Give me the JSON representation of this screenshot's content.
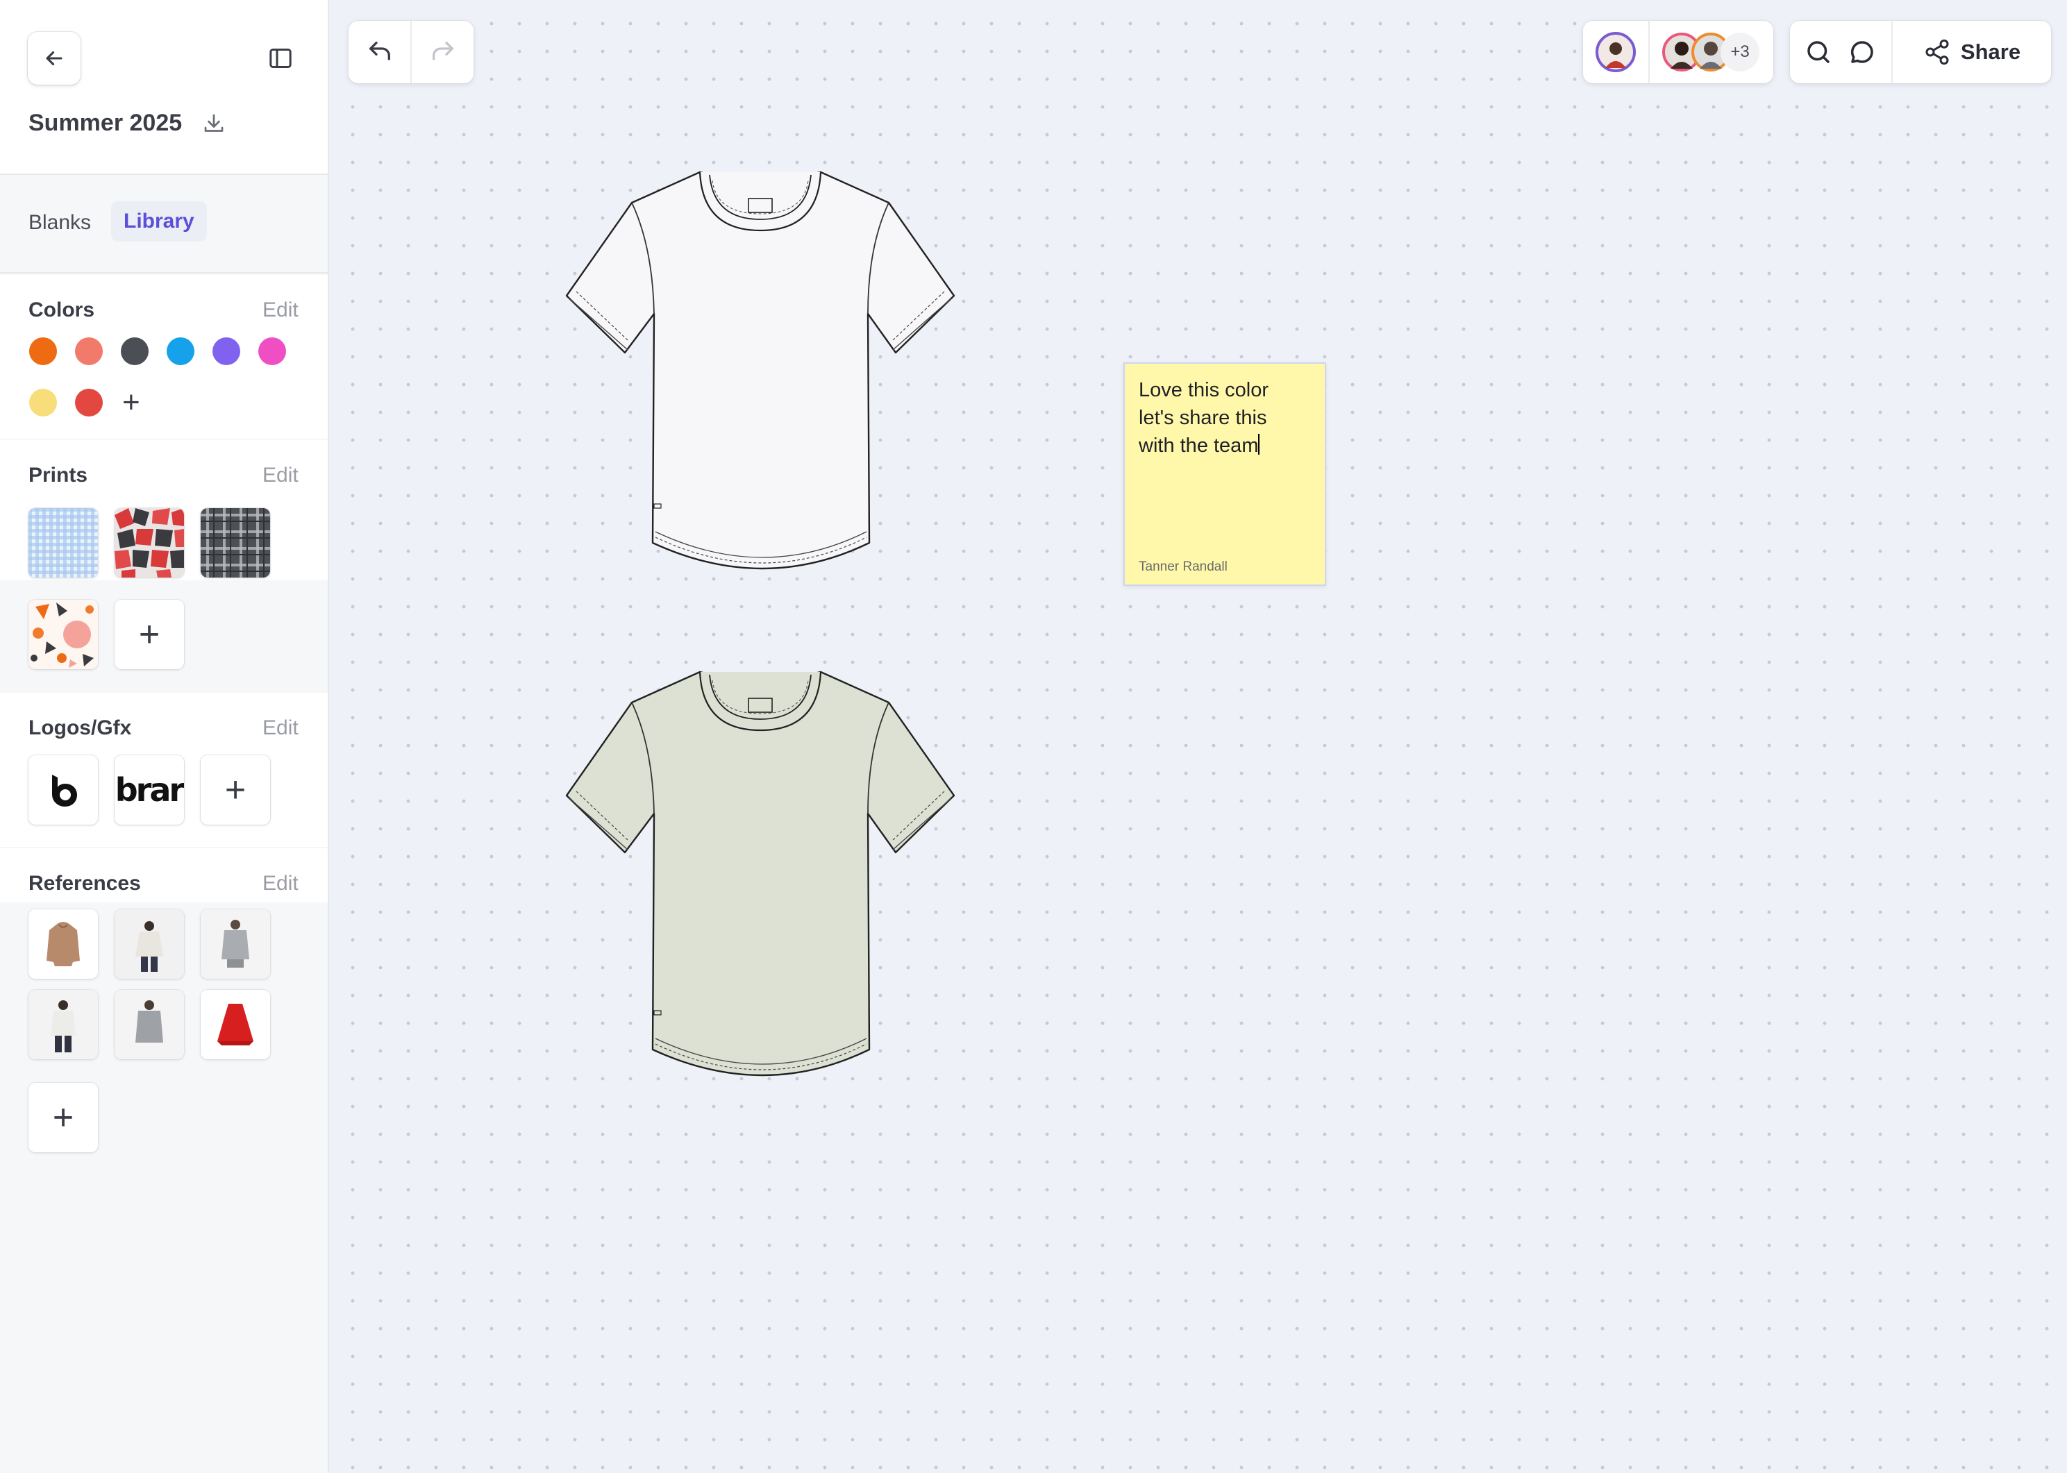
{
  "project": {
    "title": "Summer 2025"
  },
  "tabs": [
    {
      "label": "Blanks",
      "active": false
    },
    {
      "label": "Library",
      "active": true
    }
  ],
  "sections": {
    "colors": {
      "title": "Colors",
      "edit_label": "Edit",
      "swatches": [
        "#ee6a13",
        "#f17a6a",
        "#4b4f55",
        "#16a2ea",
        "#8162f0",
        "#ef4fc2",
        "#f7de7a",
        "#e2483f"
      ],
      "add_label": "+"
    },
    "prints": {
      "title": "Prints",
      "edit_label": "Edit",
      "items": [
        "blue-gingham-print",
        "red-geometric-print",
        "gray-plaid-print",
        "terrazzo-print"
      ],
      "add_label": "+"
    },
    "logos": {
      "title": "Logos/Gfx",
      "edit_label": "Edit",
      "items": [
        "b-logo",
        "brand-wordmark-logo"
      ],
      "wordmark_text": "ıbrar",
      "add_label": "+"
    },
    "references": {
      "title": "References",
      "edit_label": "Edit",
      "items": [
        "tan-hoodie-reference",
        "white-sweater-reference",
        "gray-tee-reference",
        "white-jacket-reference",
        "gray-shirt-reference",
        "red-dress-reference"
      ],
      "add_label": "+"
    }
  },
  "toolbar": {
    "undo_icon": "undo-icon",
    "redo_icon": "redo-icon",
    "collaborators_extra": "+3",
    "share_label": "Share"
  },
  "canvas": {
    "garments": [
      {
        "name": "white-tshirt",
        "color": "#f7f7fa"
      },
      {
        "name": "sage-tshirt",
        "color": "#dde1d3"
      }
    ],
    "sticky_note": {
      "text": "Love this color\nlet's share this\nwith the team",
      "author": "Tanner Randall"
    }
  },
  "colors": {
    "accent": "#5b4fd9",
    "sticky": "#fff7aa"
  }
}
